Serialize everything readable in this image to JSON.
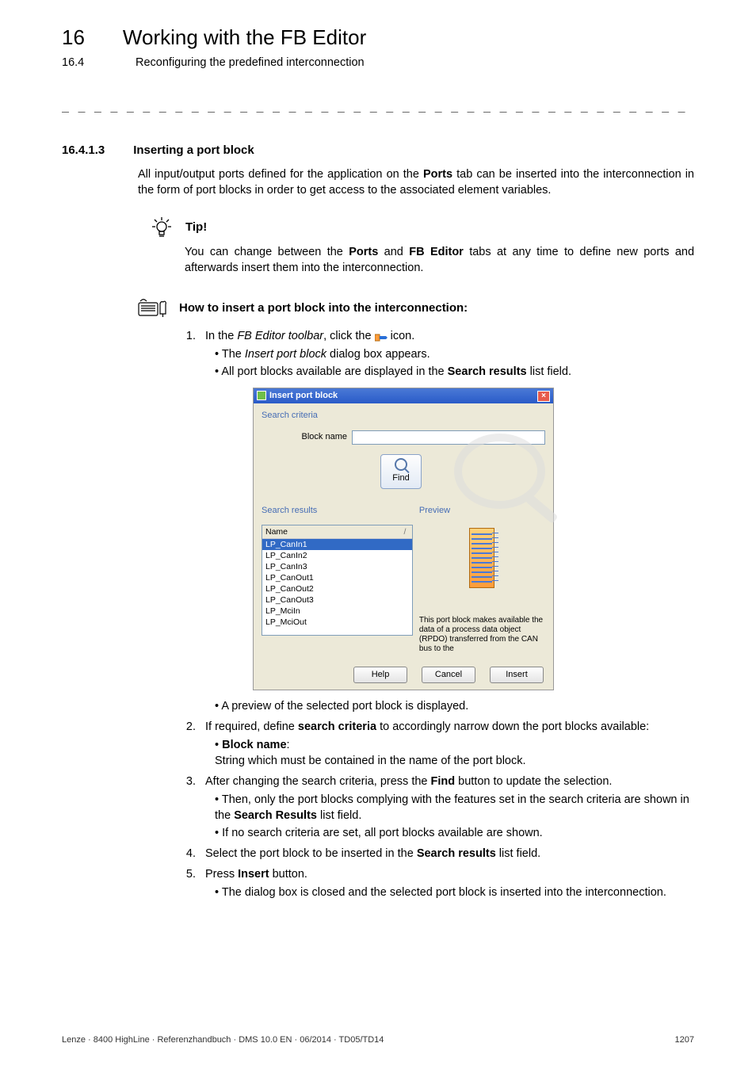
{
  "chapter": {
    "number": "16",
    "title": "Working with the FB Editor"
  },
  "section": {
    "number": "16.4",
    "title": "Reconfiguring the predefined interconnection"
  },
  "heading": {
    "number": "16.4.1.3",
    "title": "Inserting a port block"
  },
  "intro_prefix": "All input/output ports defined for the application on the ",
  "intro_ports": "Ports",
  "intro_suffix": " tab can be inserted into the interconnection in the form of port blocks in order to get access to the associated element variables.",
  "tip": {
    "label": "Tip!",
    "body_prefix": "You can change between the ",
    "ports": "Ports",
    "mid": " and ",
    "fbeditor": "FB Editor",
    "body_suffix": " tabs at any time to define new ports and afterwards insert them into the interconnection."
  },
  "howto": {
    "title": "How to insert a port block into the interconnection:"
  },
  "step1": {
    "prefix": "In the ",
    "italic": "FB Editor toolbar",
    "mid": ", click the ",
    "suffix": " icon.",
    "b1_prefix": "The ",
    "b1_italic": "Insert port block",
    "b1_suffix": " dialog box appears.",
    "b2_prefix": "All port blocks available are displayed in the ",
    "b2_bold": "Search results",
    "b2_suffix": " list field."
  },
  "dialog": {
    "title": "Insert port block",
    "search_criteria_label": "Search criteria",
    "block_name_label": "Block name",
    "find_label": "Find",
    "search_results_label": "Search results",
    "preview_label": "Preview",
    "col_name": "Name",
    "rows": [
      "LP_CanIn1",
      "LP_CanIn2",
      "LP_CanIn3",
      "LP_CanOut1",
      "LP_CanOut2",
      "LP_CanOut3",
      "LP_MciIn",
      "LP_MciOut"
    ],
    "desc": "This port block makes available the data of a process data object (RPDO) transferred from the CAN bus to the",
    "help": "Help",
    "cancel": "Cancel",
    "insert": "Insert"
  },
  "after_dialog_bullet": "A preview of the selected port block is displayed.",
  "step2": {
    "prefix": "If required, define ",
    "bold": "search criteria",
    "suffix": " to accordingly narrow down the port blocks available:",
    "b1_bold": "Block name",
    "b1_colon": ":",
    "b1_line2": "String which must be contained in the name of the port block."
  },
  "step3": {
    "prefix": "After changing the search criteria, press the ",
    "bold": "Find",
    "suffix": " button to update the selection.",
    "b1_prefix": "Then, only the port blocks complying with the features set in the search criteria are shown in the ",
    "b1_bold": "Search Results",
    "b1_suffix": " list field.",
    "b2": "If no search criteria are set, all port blocks available are shown."
  },
  "step4": {
    "prefix": "Select the port block to be inserted in the ",
    "bold": "Search results",
    "suffix": " list field."
  },
  "step5": {
    "prefix": "Press ",
    "bold": "Insert",
    "suffix": " button.",
    "b1": "The dialog box is closed and the selected port block is inserted into the interconnection."
  },
  "footer": {
    "left": "Lenze · 8400 HighLine · Referenzhandbuch · DMS 10.0 EN · 06/2014 · TD05/TD14",
    "right": "1207"
  }
}
